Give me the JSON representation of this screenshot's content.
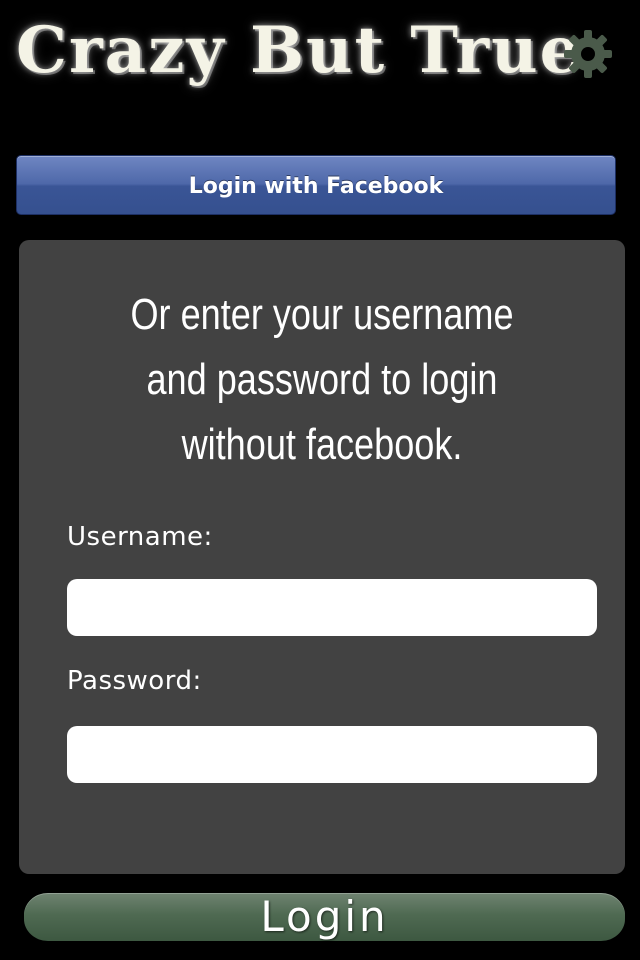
{
  "header": {
    "title": "Crazy But True",
    "settings_icon": "gear-icon",
    "settings_icon_color": "#4a5a4a"
  },
  "facebook": {
    "button_label": "Login with Facebook",
    "color": "#4e68a9"
  },
  "panel": {
    "intro_lines": [
      "Or enter your username",
      "and password to login",
      "without facebook."
    ],
    "username_label": "Username:",
    "username_value": "",
    "password_label": "Password:",
    "password_value": "",
    "background": "#424242"
  },
  "login": {
    "button_label": "Login",
    "color": "#4f6a52"
  }
}
